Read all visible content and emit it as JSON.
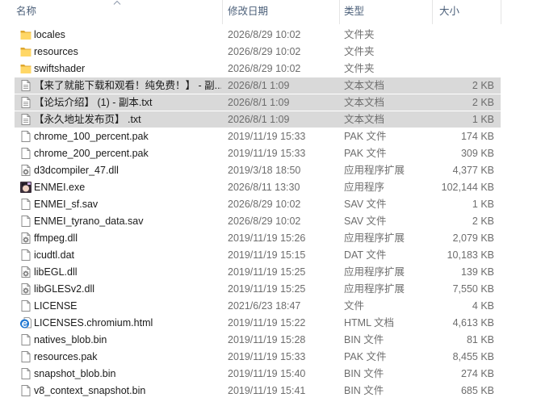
{
  "header": {
    "columns": [
      {
        "label": "名称"
      },
      {
        "label": "修改日期"
      },
      {
        "label": "类型"
      },
      {
        "label": "大小"
      }
    ],
    "sort_icon": "sort-ascending-icon"
  },
  "colors": {
    "selection": "#d9d9d9",
    "header_text": "#4c607a",
    "name_text": "#1a1a1a",
    "detail_text": "#6d6d6d",
    "divider": "#e5e5e5",
    "folder": "#ffd766"
  },
  "files": [
    {
      "name": "locales",
      "date": "2026/8/29 10:02",
      "type": "文件夹",
      "icon": "folder-icon",
      "selected": false
    },
    {
      "name": "resources",
      "date": "2026/8/29 10:02",
      "type": "文件夹",
      "icon": "folder-icon",
      "selected": false
    },
    {
      "name": "swiftshader",
      "date": "2026/8/29 10:02",
      "type": "文件夹",
      "icon": "folder-icon",
      "selected": false
    },
    {
      "name": "【来了就能下载和观看！纯免费！】 - 副...",
      "date": "2026/8/1 1:09",
      "type": "文本文档",
      "size": "2 KB",
      "icon": "text-document-icon",
      "selected": true
    },
    {
      "name": "【论坛介绍】 (1) - 副本.txt",
      "date": "2026/8/1 1:09",
      "type": "文本文档",
      "size": "2 KB",
      "icon": "text-document-icon",
      "selected": true
    },
    {
      "name": "【永久地址发布页】 .txt",
      "date": "2026/8/1 1:09",
      "type": "文本文档",
      "size": "1 KB",
      "icon": "text-document-icon",
      "selected": true
    },
    {
      "name": "chrome_100_percent.pak",
      "date": "2019/11/19 15:33",
      "type": "PAK 文件",
      "size": "174 KB",
      "icon": "file-icon",
      "selected": false
    },
    {
      "name": "chrome_200_percent.pak",
      "date": "2019/11/19 15:33",
      "type": "PAK 文件",
      "size": "309 KB",
      "icon": "file-icon",
      "selected": false
    },
    {
      "name": "d3dcompiler_47.dll",
      "date": "2019/3/18 18:50",
      "type": "应用程序扩展",
      "size": "4,377 KB",
      "icon": "dll-file-icon",
      "selected": false
    },
    {
      "name": "ENMEI.exe",
      "date": "2026/8/11 13:30",
      "type": "应用程序",
      "size": "102,144 KB",
      "icon": "app-icon",
      "selected": false
    },
    {
      "name": "ENMEI_sf.sav",
      "date": "2026/8/29 10:02",
      "type": "SAV 文件",
      "size": "1 KB",
      "icon": "file-icon",
      "selected": false
    },
    {
      "name": "ENMEI_tyrano_data.sav",
      "date": "2026/8/29 10:02",
      "type": "SAV 文件",
      "size": "2 KB",
      "icon": "file-icon",
      "selected": false
    },
    {
      "name": "ffmpeg.dll",
      "date": "2019/11/19 15:26",
      "type": "应用程序扩展",
      "size": "2,079 KB",
      "icon": "dll-file-icon",
      "selected": false
    },
    {
      "name": "icudtl.dat",
      "date": "2019/11/19 15:15",
      "type": "DAT 文件",
      "size": "10,183 KB",
      "icon": "file-icon",
      "selected": false
    },
    {
      "name": "libEGL.dll",
      "date": "2019/11/19 15:25",
      "type": "应用程序扩展",
      "size": "139 KB",
      "icon": "dll-file-icon",
      "selected": false
    },
    {
      "name": "libGLESv2.dll",
      "date": "2019/11/19 15:25",
      "type": "应用程序扩展",
      "size": "7,550 KB",
      "icon": "dll-file-icon",
      "selected": false
    },
    {
      "name": "LICENSE",
      "date": "2021/6/23 18:47",
      "type": "文件",
      "size": "4 KB",
      "icon": "file-icon",
      "selected": false
    },
    {
      "name": "LICENSES.chromium.html",
      "date": "2019/11/19 15:22",
      "type": "HTML 文档",
      "size": "4,613 KB",
      "icon": "html-icon",
      "selected": false
    },
    {
      "name": "natives_blob.bin",
      "date": "2019/11/19 15:28",
      "type": "BIN 文件",
      "size": "81 KB",
      "icon": "file-icon",
      "selected": false
    },
    {
      "name": "resources.pak",
      "date": "2019/11/19 15:33",
      "type": "PAK 文件",
      "size": "8,455 KB",
      "icon": "file-icon",
      "selected": false
    },
    {
      "name": "snapshot_blob.bin",
      "date": "2019/11/19 15:40",
      "type": "BIN 文件",
      "size": "274 KB",
      "icon": "file-icon",
      "selected": false
    },
    {
      "name": "v8_context_snapshot.bin",
      "date": "2019/11/19 15:41",
      "type": "BIN 文件",
      "size": "685 KB",
      "icon": "file-icon",
      "selected": false
    }
  ]
}
